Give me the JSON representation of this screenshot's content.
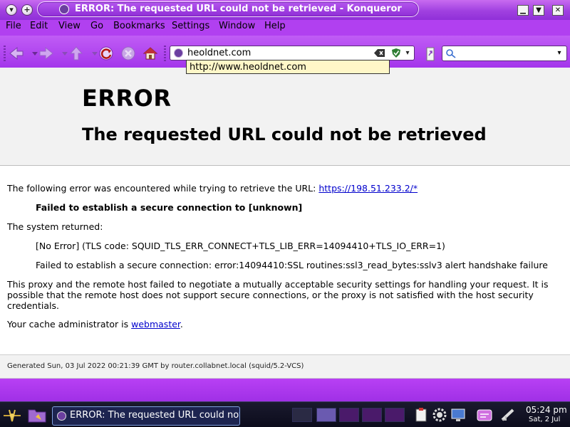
{
  "window": {
    "title": "ERROR: The requested URL could not be retrieved - Konqueror",
    "menu_button_glyph": "▾",
    "sticky_button_glyph": "+",
    "minimize_glyph": "▁",
    "maximize_glyph": "▼",
    "close_glyph": "✕"
  },
  "menubar": {
    "items": [
      "File",
      "Edit",
      "View",
      "Go",
      "Bookmarks",
      "Settings",
      "Window",
      "Help"
    ]
  },
  "toolbar": {
    "icons": [
      "back-icon",
      "forward-icon",
      "up-icon",
      "reload-icon",
      "stop-icon",
      "home-icon"
    ],
    "location_value": "heoldnet.com",
    "dropdown_glyph": "▾",
    "search_value": "",
    "search_dropdown_glyph": "▾"
  },
  "autocomplete": {
    "suggestion": "http://www.heoldnet.com"
  },
  "page": {
    "heading": "ERROR",
    "subheading": "The requested URL could not be retrieved",
    "intro_text": "The following error was encountered while trying to retrieve the URL: ",
    "intro_link": "https://198.51.233.2/*",
    "error_reason": "Failed to establish a secure connection to [unknown]",
    "system_returned": "The system returned:",
    "tls_code": "[No Error] (TLS code: SQUID_TLS_ERR_CONNECT+TLS_LIB_ERR=14094410+TLS_IO_ERR=1)",
    "ssl_error": "Failed to establish a secure connection: error:14094410:SSL routines:ssl3_read_bytes:sslv3 alert handshake failure",
    "explanation": "This proxy and the remote host failed to negotiate a mutually acceptable security settings for handling your request. It is possible that the remote host does not support secure connections, or the proxy is not satisfied with the host security credentials.",
    "admin_text": "Your cache administrator is ",
    "admin_link": "webmaster",
    "admin_suffix": ".",
    "footer": "Generated Sun, 03 Jul 2022 00:21:39 GMT by router.collabnet.local (squid/5.2-VCS)"
  },
  "taskbar": {
    "task_title": "ERROR: The requested URL could not",
    "clock_time": "05:24 pm",
    "clock_date": "Sat, 2 Jul"
  },
  "colors": {
    "accent": "#a63aea",
    "link": "#0000cc",
    "autocomplete_bg": "#fff7c8",
    "taskbar_bg": "#12121f"
  }
}
